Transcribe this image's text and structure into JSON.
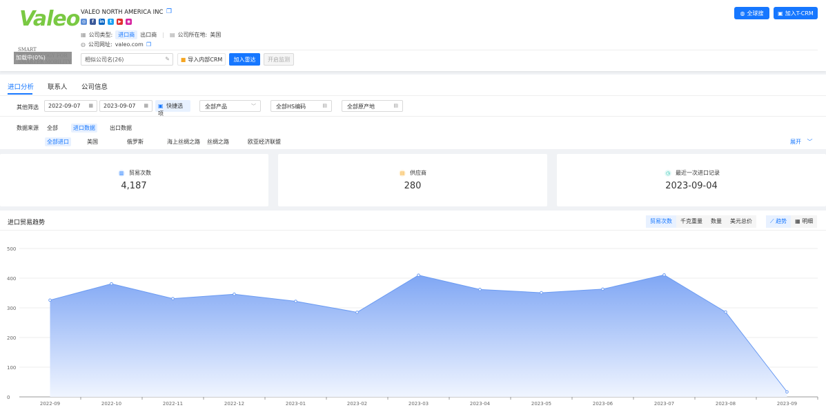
{
  "company": {
    "name": "VALEO NORTH AMERICA INC",
    "logo_word": "Valeo",
    "logo_tagline": "SMART TECHNOLOGY FOR SMARTER MOBILITY",
    "logo_badge": "加载中(0%)",
    "type_label": "公司类型:",
    "type_importer": "进口商",
    "type_exporter": "出口商",
    "location_label": "公司所在地:",
    "location_value": "美国",
    "website_label": "公司网址:",
    "website_value": "valeo.com",
    "social_icons": [
      "website-icon",
      "facebook-icon",
      "linkedin-icon",
      "twitter-icon",
      "youtube-icon",
      "instagram-icon"
    ]
  },
  "header_actions": {
    "similar_companies": "相似公司名(26)",
    "import_crm": "导入内部CRM",
    "add_radar": "加入雷达",
    "start_monitor": "开启监测",
    "global_search": "全球搜",
    "add_tcrm": "加入T-CRM"
  },
  "tabs": [
    "进口分析",
    "联系人",
    "公司信息"
  ],
  "filters": {
    "label": "其他筛选",
    "date_from": "2022-09-07",
    "date_to": "2023-09-07",
    "quick_options": "快捷选项",
    "product": "全部产品",
    "hs_code": "全部HS编码",
    "origin": "全部原产地"
  },
  "data_source": {
    "label": "数据来源",
    "options": [
      "全部",
      "进口数据",
      "出口数据"
    ],
    "sub_options": [
      "全部进口",
      "美国",
      "俄罗斯",
      "海上丝绸之路",
      "丝绸之路",
      "欧亚经济联盟"
    ],
    "expand": "展开"
  },
  "stats": [
    {
      "label": "贸易次数",
      "value": "4,187",
      "icon": "bar-chart-icon"
    },
    {
      "label": "供应商",
      "value": "280",
      "icon": "supplier-icon"
    },
    {
      "label": "最近一次进口记录",
      "value": "2023-09-04",
      "icon": "clock-icon"
    }
  ],
  "trend": {
    "title": "进口贸易趋势",
    "metrics": [
      "贸易次数",
      "千克重量",
      "数量",
      "美元总价"
    ],
    "views": [
      "趋势",
      "明细"
    ]
  },
  "chart_data": {
    "type": "area",
    "categories": [
      "2022-09",
      "2022-10",
      "2022-11",
      "2022-12",
      "2023-01",
      "2023-02",
      "2023-03",
      "2023-04",
      "2023-05",
      "2023-06",
      "2023-07",
      "2023-08",
      "2023-09"
    ],
    "series": [
      {
        "values": [
          326,
          381,
          331,
          346,
          322,
          285,
          410,
          362,
          351,
          363,
          411,
          286,
          17
        ]
      }
    ],
    "yticks": [
      0,
      100,
      200,
      300,
      400,
      500
    ],
    "ylim": [
      0,
      500
    ],
    "grid": true,
    "colors": {
      "line": "#6b9bf2",
      "fill_top": "#7fa6f4",
      "fill_bottom": "#f0f5ff"
    }
  }
}
